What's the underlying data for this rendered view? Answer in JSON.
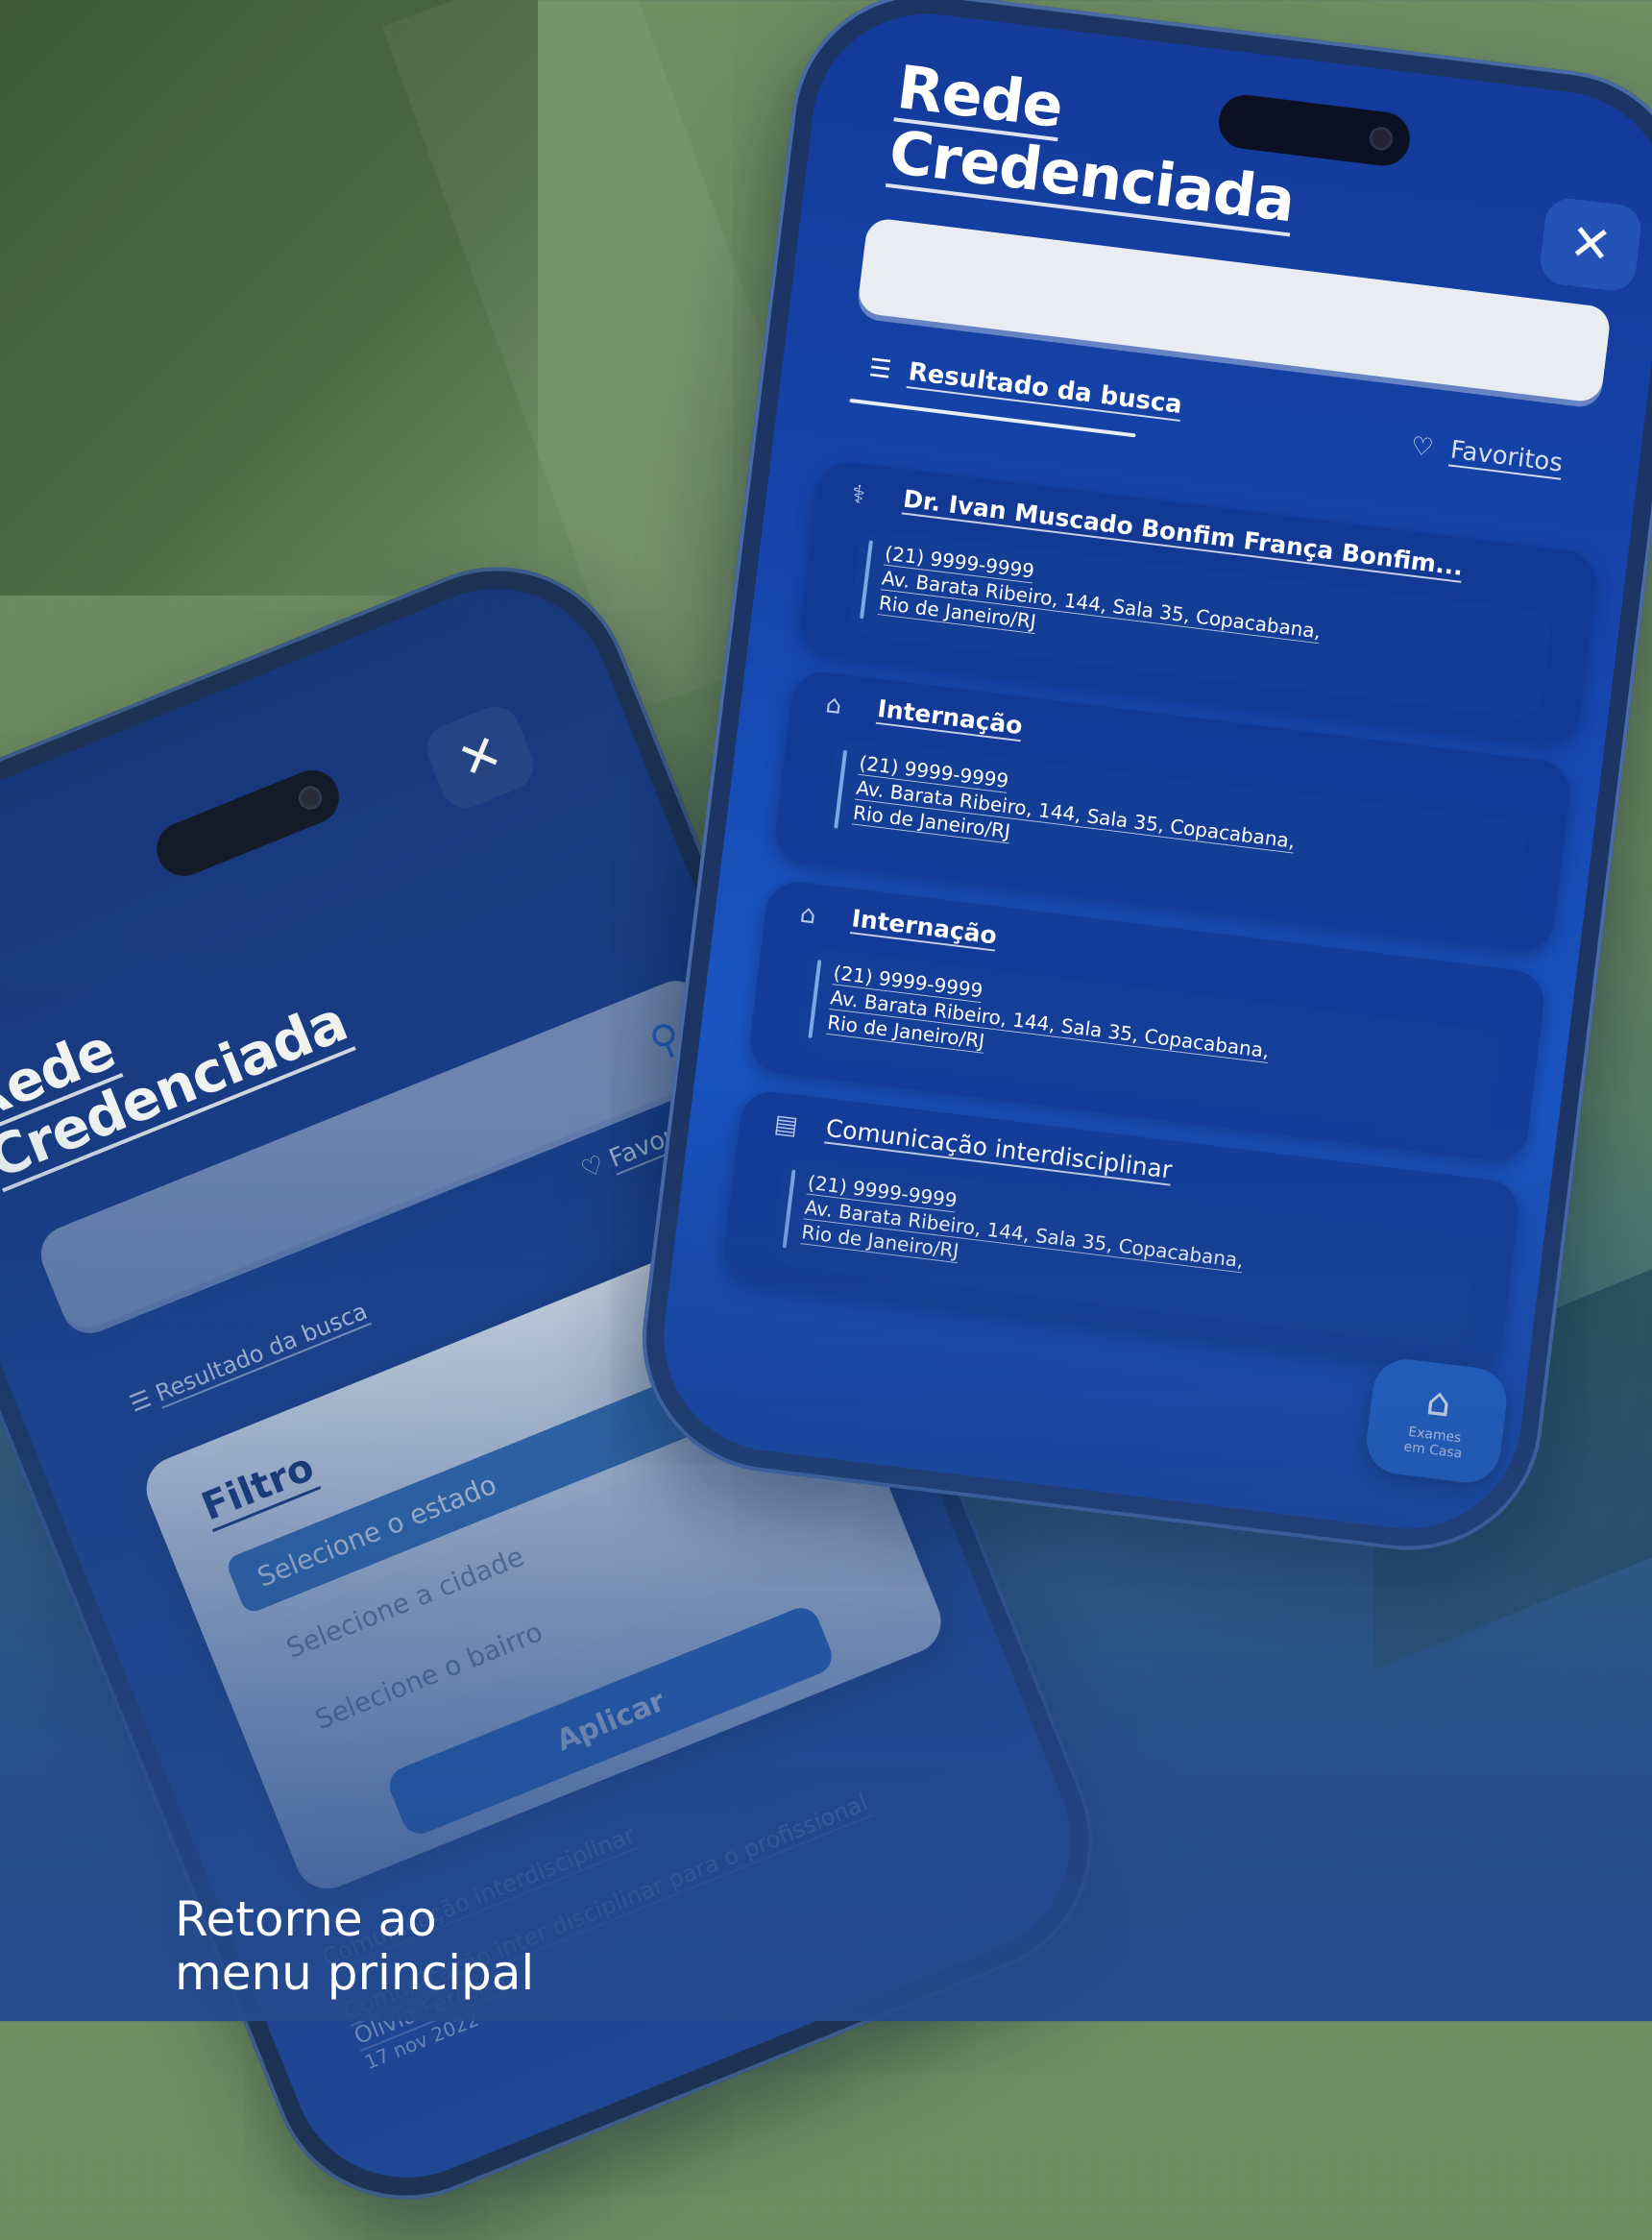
{
  "footer": {
    "line1": "Retorne ao",
    "line2": "menu principal"
  },
  "right_phone": {
    "title_line1": "Rede",
    "title_line2": "Credenciada",
    "close_icon": "close-icon",
    "search": {
      "value": ""
    },
    "tabs": {
      "results": "Resultado da busca",
      "favorites": "Favoritos"
    },
    "results": [
      {
        "icon": "stethoscope-icon",
        "name": "Dr. Ivan Muscado Bonfim França Bonfim...",
        "phone": "(21) 9999-9999",
        "address1": "Av. Barata Ribeiro, 144, Sala 35, Copacabana,",
        "address2": "Rio de Janeiro/RJ"
      },
      {
        "icon": "hospital-icon",
        "name": "Internação",
        "phone": "(21) 9999-9999",
        "address1": "Av. Barata Ribeiro, 144, Sala 35, Copacabana,",
        "address2": "Rio de Janeiro/RJ"
      },
      {
        "icon": "hospital-icon",
        "name": "Internação",
        "phone": "(21) 9999-9999",
        "address1": "Av. Barata Ribeiro, 144, Sala 35, Copacabana,",
        "address2": "Rio de Janeiro/RJ"
      },
      {
        "icon": "document-icon",
        "name": "Comunicação interdisciplinar",
        "phone": "(21) 9999-9999",
        "address1": "Av. Barata Ribeiro, 144, Sala 35, Copacabana,",
        "address2": "Rio de Janeiro/RJ"
      }
    ],
    "fab": {
      "line1": "Exames",
      "line2": "em Casa"
    }
  },
  "left_phone": {
    "title_line1": "Rede",
    "title_line2": "Credenciada",
    "favorites": "Favoritos",
    "results_tab": "Resultado da busca",
    "filter": {
      "title": "Filtro",
      "state": "Selecione o estado",
      "city": "Selecione a cidade",
      "neighborhood": "Selecione o bairro",
      "apply": "Aplicar"
    },
    "bg_items": {
      "item1": "Comunicação interdisciplinar",
      "item2": "Comunicação inter disciplinar para o profissional",
      "author": "Olivia Ferreira",
      "date": "17 nov 2022"
    }
  },
  "colors": {
    "screen_blue": "#1648b0",
    "accent_blue": "#1f66c7",
    "filter_selected": "#2f6fb8",
    "background_green": "#6f8f63"
  }
}
